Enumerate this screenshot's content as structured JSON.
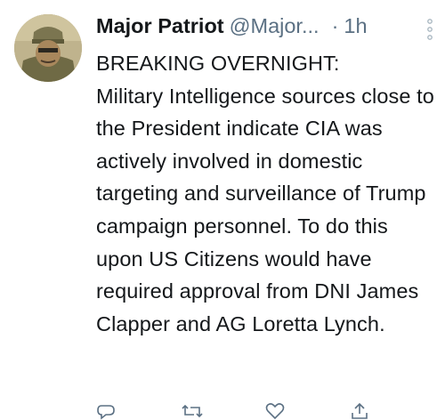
{
  "tweet": {
    "display_name": "Major Patriot",
    "handle": "@Major...",
    "dot": "·",
    "time": "1h",
    "text": "BREAKING OVERNIGHT:\nMilitary Intelligence sources close to the President indicate CIA was actively involved in domestic targeting and surveillance of Trump campaign personnel.  To do this upon US Citizens would have required approval from DNI James Clapper and AG Loretta Lynch."
  },
  "icons": {
    "avatar": "avatar-soldier-photo",
    "more": "more-vertical-icon",
    "reply": "reply-icon",
    "retweet": "retweet-icon",
    "like": "like-icon",
    "share": "share-icon"
  },
  "colors": {
    "text": "#14171a",
    "secondary": "#5b7083"
  }
}
